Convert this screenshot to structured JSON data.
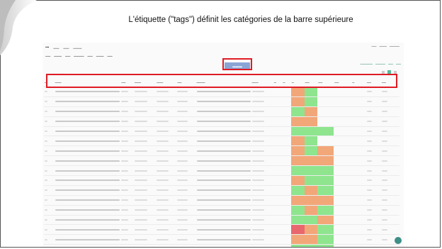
{
  "caption": "L'étiquette (\"tags\") définit les catégories de la barre supérieure",
  "colors": {
    "highlight": "#e01b24",
    "status_green": "#8ee58e",
    "status_orange": "#f2a779",
    "status_red": "#e9686e",
    "filter_button": "#8aa4d6",
    "fab": "#3e8f86"
  },
  "table": {
    "status_rows": [
      [
        "c-w",
        "c-o",
        "c-g",
        "c-w",
        "c-w",
        "c-w"
      ],
      [
        "c-w",
        "c-o",
        "c-g",
        "c-w",
        "c-w",
        "c-w"
      ],
      [
        "c-w",
        "c-g",
        "c-o",
        "c-w",
        "c-w",
        "c-w"
      ],
      [
        "c-w",
        "c-o",
        "c-o",
        "c-w",
        "c-w",
        "c-w"
      ],
      [
        "c-w",
        "c-g",
        "c-g",
        "c-g",
        "c-w",
        "c-w"
      ],
      [
        "c-w",
        "c-o",
        "c-g",
        "c-w",
        "c-w",
        "c-w"
      ],
      [
        "c-w",
        "c-o",
        "c-g",
        "c-o",
        "c-w",
        "c-w"
      ],
      [
        "c-w",
        "c-o",
        "c-o",
        "c-o",
        "c-w",
        "c-w"
      ],
      [
        "c-w",
        "c-g",
        "c-g",
        "c-g",
        "c-w",
        "c-w"
      ],
      [
        "c-w",
        "c-o",
        "c-g",
        "c-g",
        "c-w",
        "c-w"
      ],
      [
        "c-w",
        "c-g",
        "c-o",
        "c-g",
        "c-w",
        "c-w"
      ],
      [
        "c-w",
        "c-o",
        "c-o",
        "c-o",
        "c-w",
        "c-w"
      ],
      [
        "c-w",
        "c-g",
        "c-o",
        "c-g",
        "c-w",
        "c-w"
      ],
      [
        "c-w",
        "c-g",
        "c-g",
        "c-o",
        "c-w",
        "c-w"
      ],
      [
        "c-w",
        "c-r",
        "c-o",
        "c-g",
        "c-w",
        "c-w"
      ],
      [
        "c-w",
        "c-o",
        "c-o",
        "c-g",
        "c-w",
        "c-w"
      ],
      [
        "c-w",
        "c-g",
        "c-g",
        "c-g",
        "c-w",
        "c-w"
      ]
    ]
  }
}
